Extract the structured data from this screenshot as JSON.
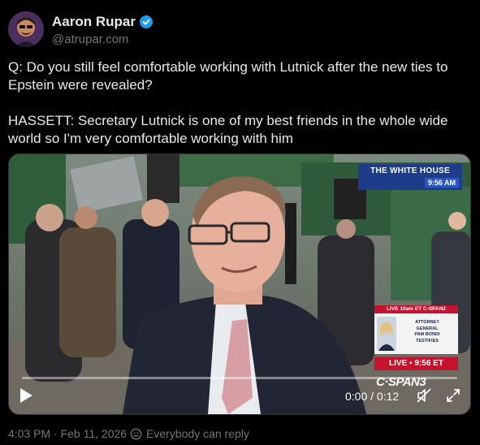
{
  "author": {
    "display_name": "Aaron Rupar",
    "handle": "@atrupar.com",
    "verified": true,
    "verified_color": "#1d9bf0"
  },
  "tweet": {
    "paragraphs": [
      "Q: Do you still feel comfortable working with Lutnick after the new ties to Epstein were revealed?",
      "HASSETT: Secretary Lutnick is one of my best friends in the whole wide world so I'm very comfortable working with him"
    ]
  },
  "video": {
    "overlay": {
      "white_house": "THE WHITE HOUSE",
      "white_house_time": "9:56 AM",
      "live_strip": "LIVE 10am ET  C-SPAN2",
      "bondi_caption": "ATTORNEY\nGENERAL\nPAM BONDI\nTESTIFIES",
      "live_time": "LIVE ▪ 9:56 ET",
      "network": "C·SPAN3"
    },
    "time_readout": "0:00 / 0:12",
    "progress": 0,
    "controls": {
      "play_icon": "play-icon",
      "mute_icon": "muted-speaker-icon",
      "fullscreen_icon": "expand-icon"
    }
  },
  "footer": {
    "timestamp": "4:03 PM · Feb 11, 2026",
    "reply_setting": "Everybody can reply"
  }
}
